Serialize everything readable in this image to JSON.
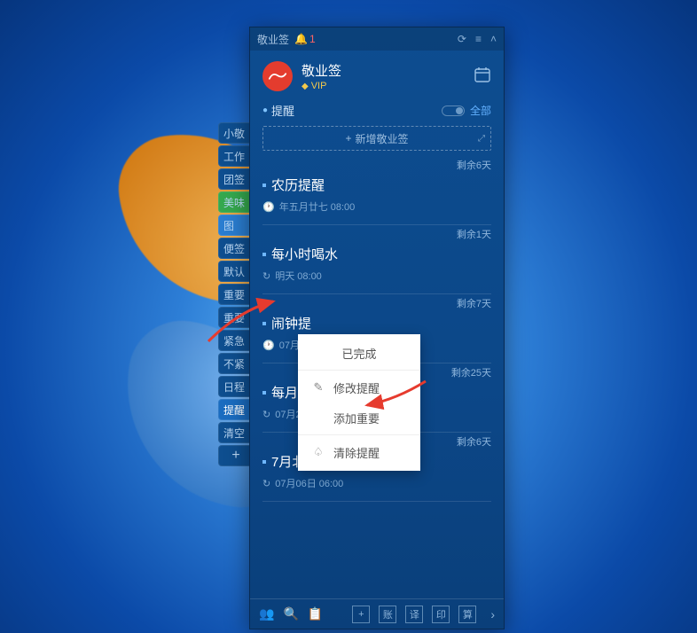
{
  "titlebar": {
    "app_label": "敬业签",
    "notification_count": "1"
  },
  "header": {
    "app_name": "敬业签",
    "vip_label": "VIP"
  },
  "filter": {
    "label": "提醒",
    "all_label": "全部"
  },
  "add_bar": {
    "label": "新增敬业签"
  },
  "side_tabs": [
    "小敬",
    "工作",
    "团签",
    "美味",
    "图",
    "便签",
    "默认",
    "重要",
    "重要",
    "紧急",
    "不紧",
    "日程",
    "提醒",
    "清空"
  ],
  "side_add": "+",
  "items": [
    {
      "remain": "剩余6天",
      "title": "农历提醒",
      "time_icon": "clock",
      "time": "年五月廿七 08:00"
    },
    {
      "remain": "剩余1天",
      "title": "每小时喝水",
      "time_icon": "repeat",
      "time": "明天 08:00"
    },
    {
      "remain": "剩余7天",
      "title": "闹钟提",
      "time_icon": "clock",
      "time": "07月06"
    },
    {
      "remain": "剩余25天",
      "title": "每月过",
      "time_icon": "repeat",
      "time": "07月25日"
    },
    {
      "remain": "剩余6天",
      "title": "7月北京周二限号2和7",
      "time_icon": "repeat",
      "time": "07月06日 06:00"
    }
  ],
  "context_menu": {
    "done": "已完成",
    "edit": "修改提醒",
    "important": "添加重要",
    "clear": "清除提醒"
  },
  "bottom": {
    "btn1": "+",
    "btn2": "账",
    "btn3": "译",
    "btn4": "印",
    "btn5": "算"
  }
}
